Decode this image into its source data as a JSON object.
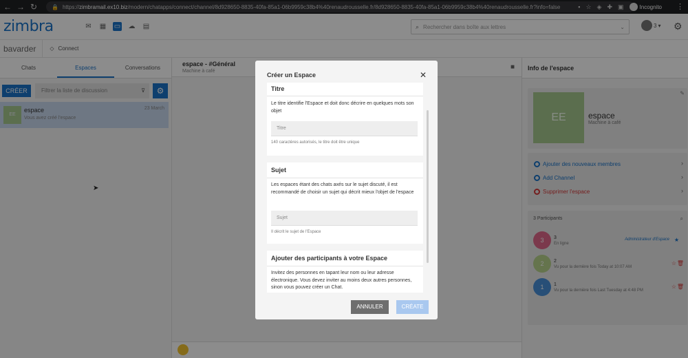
{
  "browser": {
    "url_scheme": "https://",
    "url_host": "zimbramail.ex10.biz",
    "url_path": "/modern/chatapps/connect/channel/8d928650-8835-40fa-85a1-06b9959c38b4%40renaudrousselle.fr/8d928650-8835-40fa-85a1-06b9959c38b4%40renaudrousselle.fr?info=false",
    "incognito_label": "Incognito"
  },
  "app": {
    "logo": "zimbra",
    "search_placeholder": "Rechercher dans boîte aux lettres",
    "user_count": "3",
    "section_title": "bavarder",
    "connect_label": "Connect"
  },
  "left": {
    "tabs": [
      "Chats",
      "Espaces",
      "Conversations"
    ],
    "create_label": "CRÉER",
    "filter_placeholder": "Filtrer la liste de discussion",
    "conversation": {
      "initials": "EE",
      "name": "espace",
      "subtitle": "Vous avez créé l'espace",
      "date": "23 March"
    }
  },
  "middle": {
    "title": "espace - #Général",
    "subtitle": "Machine à café"
  },
  "right": {
    "header": "Info de l'espace",
    "space": {
      "initials": "EE",
      "name": "espace",
      "subtitle": "Machine à café"
    },
    "actions": [
      {
        "label": "Ajouter des nouveaux membres"
      },
      {
        "label": "Add Channel"
      },
      {
        "label": "Supprimer l'espace"
      }
    ],
    "participants_header": "3 Participants",
    "participants": [
      {
        "initial": "3",
        "name": "3",
        "status": "En ligne",
        "role": "Administrateur d'Espace",
        "color": "#e0698a"
      },
      {
        "initial": "2",
        "name": "2",
        "status": "Vu pour la dernière fois Today at 10:07 AM",
        "role": "",
        "color": "#b9d38c"
      },
      {
        "initial": "1",
        "name": "1",
        "status": "Vu pour la dernière fois Last Tuesday at 4:48 PM",
        "role": "",
        "color": "#4a90d9"
      }
    ]
  },
  "modal": {
    "title": "Créer un Espace",
    "sections": {
      "titre": {
        "heading": "Titre",
        "description": "Le titre identifie l'Espace et doit donc décrire en quelques mots son objet",
        "placeholder": "Titre",
        "hint": "140 caractères autorisés, le titre doit être unique"
      },
      "sujet": {
        "heading": "Sujet",
        "description": "Les espaces étant des chats axés sur le sujet discuté, il est recommandé de choisir un sujet qui décrit mieux l'objet de l'espace",
        "placeholder": "Sujet",
        "hint": "Il décrit le sujet de l'Espace"
      },
      "participants": {
        "heading": "Ajouter des participants à votre Espace",
        "description": "Invitez des personnes en tapant leur nom ou leur adresse électronique. Vous devez inviter au moins deux autres personnes, sinon vous pouvez créer un Chat."
      }
    },
    "cancel_label": "ANNULER",
    "create_label": "CRÉATE"
  }
}
